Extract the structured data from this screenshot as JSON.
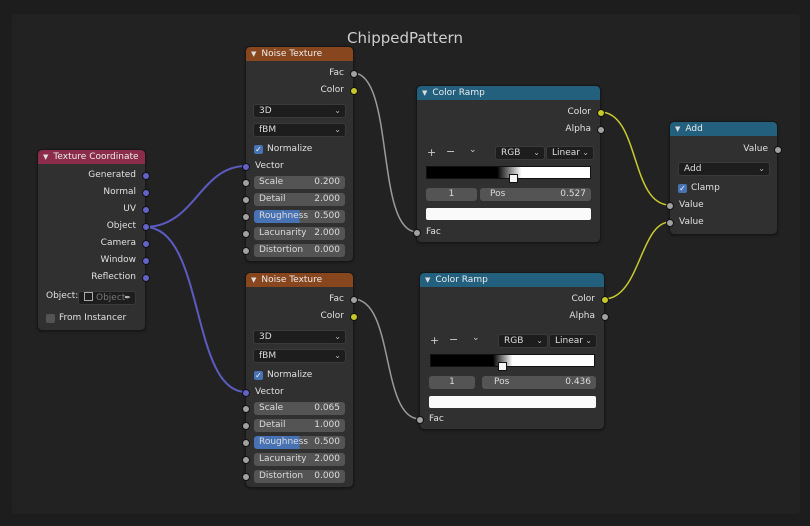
{
  "frame": {
    "title": "ChippedPattern"
  },
  "colors": {
    "texture_header": "#8a2c4a",
    "noise_header": "#87461e",
    "ramp_header": "#22607e",
    "add_header": "#22607e",
    "vector_socket": "#6363c7",
    "color_socket": "#c7c729",
    "float_socket": "#a1a1a1",
    "accent": "#4772b3"
  },
  "texcoord": {
    "title": "Texture Coordinate",
    "outputs": [
      "Generated",
      "Normal",
      "UV",
      "Object",
      "Camera",
      "Window",
      "Reflection"
    ],
    "object_label": "Object:",
    "object_placeholder": "Object",
    "from_instancer": "From Instancer"
  },
  "noise1": {
    "title": "Noise Texture",
    "outputs": [
      "Fac",
      "Color"
    ],
    "dimensions": "3D",
    "type": "fBM",
    "normalize": "Normalize",
    "vector": "Vector",
    "params": [
      {
        "label": "Scale",
        "value": "0.200"
      },
      {
        "label": "Detail",
        "value": "2.000"
      },
      {
        "label": "Roughness",
        "value": "0.500"
      },
      {
        "label": "Lacunarity",
        "value": "2.000"
      },
      {
        "label": "Distortion",
        "value": "0.000"
      }
    ]
  },
  "noise2": {
    "title": "Noise Texture",
    "outputs": [
      "Fac",
      "Color"
    ],
    "dimensions": "3D",
    "type": "fBM",
    "normalize": "Normalize",
    "vector": "Vector",
    "params": [
      {
        "label": "Scale",
        "value": "0.065"
      },
      {
        "label": "Detail",
        "value": "1.000"
      },
      {
        "label": "Roughness",
        "value": "0.500"
      },
      {
        "label": "Lacunarity",
        "value": "2.000"
      },
      {
        "label": "Distortion",
        "value": "0.000"
      }
    ]
  },
  "ramp1": {
    "title": "Color Ramp",
    "outputs": [
      "Color",
      "Alpha"
    ],
    "mode": "RGB",
    "interp": "Linear",
    "index": "1",
    "pos_label": "Pos",
    "pos_value": "0.527",
    "input": "Fac"
  },
  "ramp2": {
    "title": "Color Ramp",
    "outputs": [
      "Color",
      "Alpha"
    ],
    "mode": "RGB",
    "interp": "Linear",
    "index": "1",
    "pos_label": "Pos",
    "pos_value": "0.436",
    "input": "Fac"
  },
  "add": {
    "title": "Add",
    "output": "Value",
    "operation": "Add",
    "clamp": "Clamp",
    "inputs": [
      "Value",
      "Value"
    ]
  }
}
